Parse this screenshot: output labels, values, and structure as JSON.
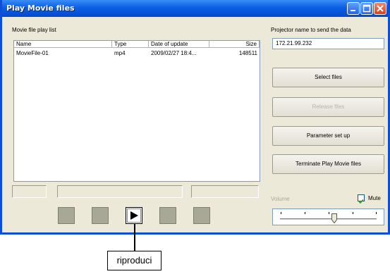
{
  "window": {
    "title": "Play Movie files"
  },
  "playlist": {
    "label": "Movie file play list",
    "columns": [
      "Name",
      "Type",
      "Date of update",
      "Size"
    ],
    "rows": [
      {
        "name": "MovieFile-01",
        "type": "mp4",
        "date": "2009/02/27 18:4...",
        "size": "148511"
      }
    ]
  },
  "projector": {
    "label": "Projector name to send the data",
    "value": "172.21.99.232"
  },
  "buttons": {
    "select_files": "Select files",
    "release_files": "Release files",
    "parameter_setup": "Parameter set up",
    "terminate": "Terminate Play Movie files"
  },
  "volume": {
    "label": "Volume",
    "mute_label": "Mute",
    "mute_checked": true,
    "level": 0.56
  },
  "callout": {
    "text": "riproduci"
  },
  "colors": {
    "titlebar": "#0b5fe3",
    "dialog_bg": "#ece9d8",
    "transport_buttons": "#a7a896"
  }
}
